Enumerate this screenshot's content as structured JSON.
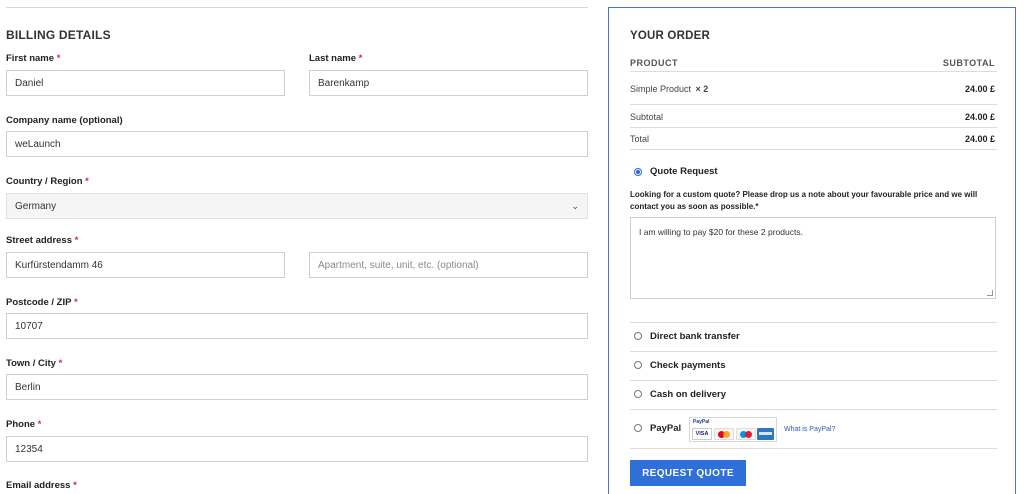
{
  "billing": {
    "title": "BILLING DETAILS",
    "required_mark": "*",
    "first_name": {
      "label": "First name",
      "value": "Daniel"
    },
    "last_name": {
      "label": "Last name",
      "value": "Barenkamp"
    },
    "company": {
      "label": "Company name (optional)",
      "value": "weLaunch"
    },
    "country": {
      "label": "Country / Region",
      "value": "Germany"
    },
    "street": {
      "label": "Street address",
      "value": "Kurfürstendamm 46",
      "placeholder2": "Apartment, suite, unit, etc. (optional)"
    },
    "postcode": {
      "label": "Postcode / ZIP",
      "value": "10707"
    },
    "city": {
      "label": "Town / City",
      "value": "Berlin"
    },
    "phone": {
      "label": "Phone",
      "value": "12354"
    },
    "email": {
      "label": "Email address"
    }
  },
  "order": {
    "title": "YOUR ORDER",
    "col_product": "PRODUCT",
    "col_subtotal": "SUBTOTAL",
    "item_name": "Simple Product",
    "item_qty": "× 2",
    "item_total": "24.00 £",
    "subtotal_label": "Subtotal",
    "subtotal_value": "24.00 £",
    "total_label": "Total",
    "total_value": "24.00 £"
  },
  "payment": {
    "quote_request": "Quote Request",
    "quote_description": "Looking for a custom quote? Please drop us a note about your favourable price and we will contact you as soon as possible.",
    "quote_required_mark": "*",
    "quote_text": "I am willing to pay $20 for these 2 products.",
    "bank_transfer": "Direct bank transfer",
    "check": "Check payments",
    "cod": "Cash on delivery",
    "paypal": "PayPal",
    "paypal_logo_text": "PayPal",
    "visa_text": "VISA",
    "what_is_paypal": "What is PayPal?",
    "button": "REQUEST QUOTE"
  },
  "icons": {
    "select_chevron": "chevron-down-icon",
    "radio": "radio-button-icon"
  },
  "colors": {
    "accent": "#2f6fd8",
    "panel_border": "#4a74c9",
    "required": "#d03030"
  }
}
